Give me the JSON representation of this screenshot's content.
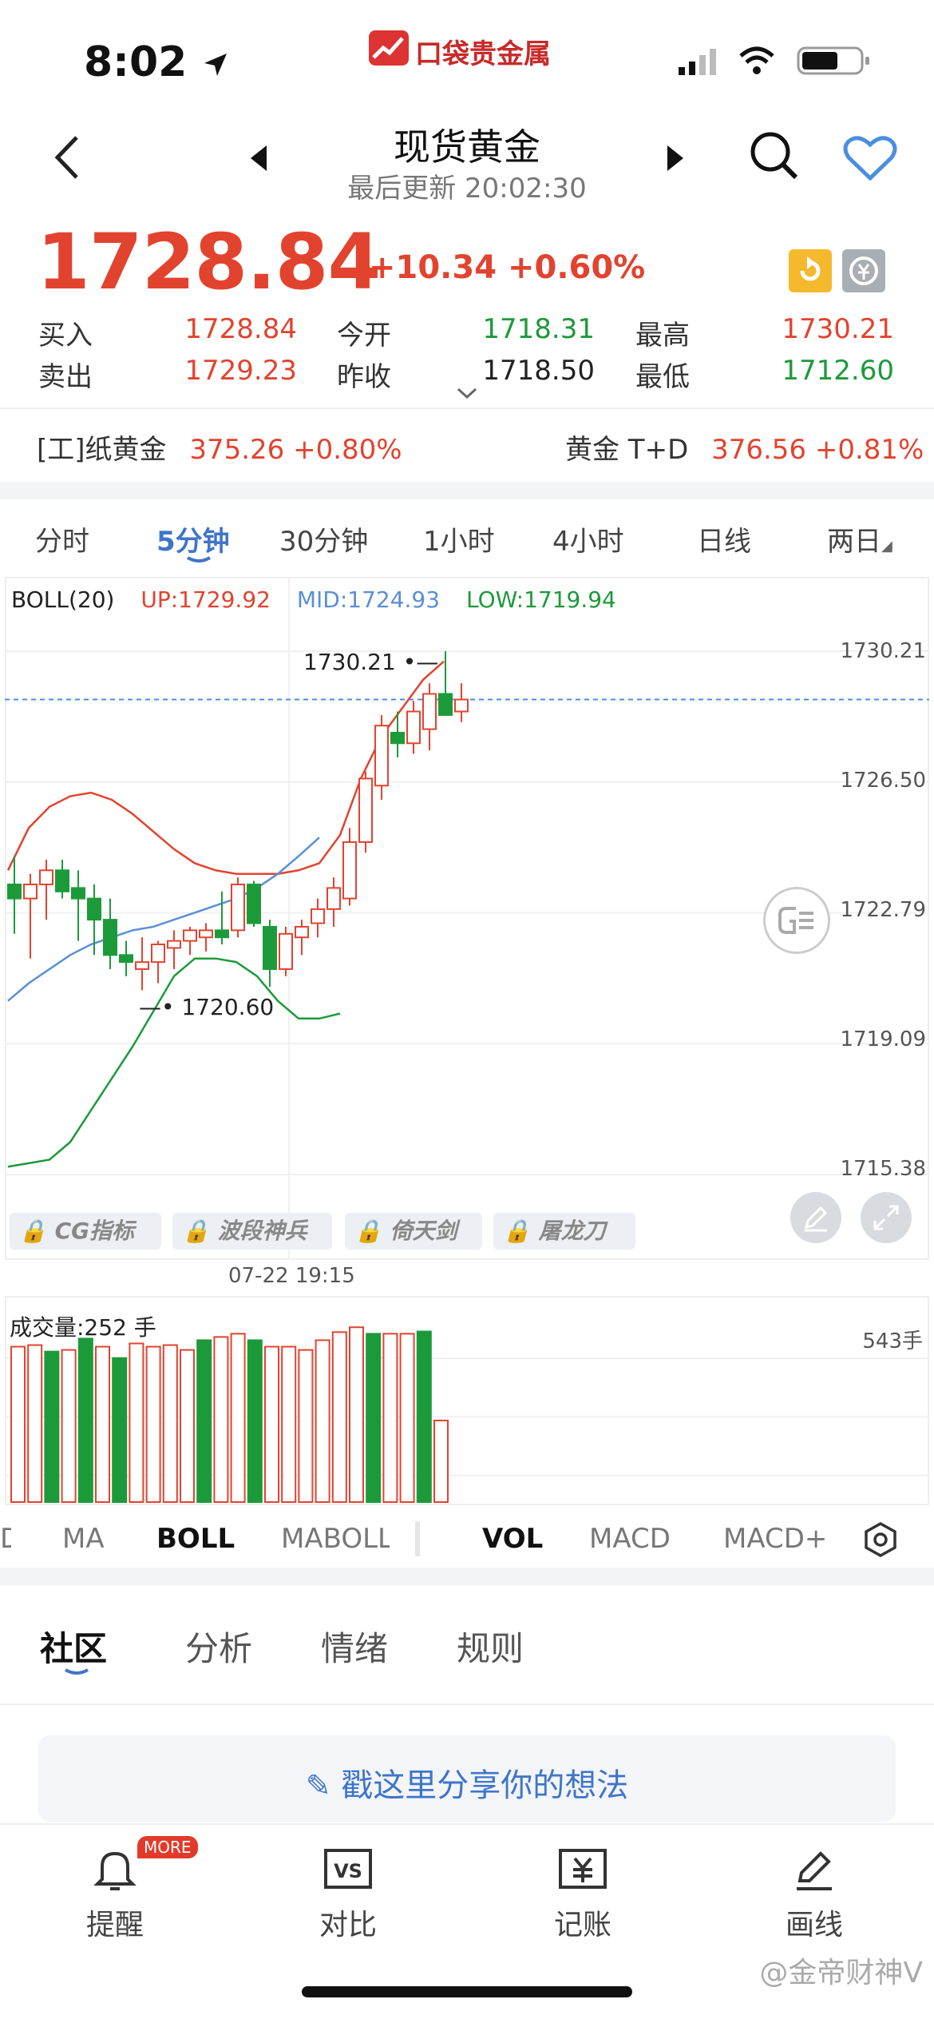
{
  "status_bar": {
    "time": "8:02",
    "app_logo_text": "口袋贵金属",
    "logo_small": "KOUDAI"
  },
  "header": {
    "title": "现货黄金",
    "subtitle": "最后更新 20:02:30"
  },
  "price": {
    "main": "1728.84",
    "change": "+10.34 +0.60%"
  },
  "quote": {
    "buy_label": "买入",
    "buy_value": "1728.84",
    "sell_label": "卖出",
    "sell_value": "1729.23",
    "open_label": "今开",
    "open_value": "1718.31",
    "prev_label": "昨收",
    "prev_value": "1718.50",
    "high_label": "最高",
    "high_value": "1730.21",
    "low_label": "最低",
    "low_value": "1712.60"
  },
  "related": {
    "paper_gold_name": "[工]纸黄金",
    "paper_gold_value": "375.26 +0.80%",
    "td_name": "黄金 T+D",
    "td_value": "376.56 +0.81%"
  },
  "period_tabs": [
    "分时",
    "5分钟",
    "30分钟",
    "1小时",
    "4小时",
    "日线",
    "两日"
  ],
  "boll": {
    "name": "BOLL(20)",
    "up": "UP:1729.92",
    "mid": "MID:1724.93",
    "low": "LOW:1719.94"
  },
  "chart_data": {
    "type": "candlestick",
    "y_ticks": [
      "1730.21",
      "1726.50",
      "1722.79",
      "1719.09",
      "1715.38"
    ],
    "ylim": [
      1715.38,
      1730.21
    ],
    "last_price": 1728.84,
    "high_marker": "1730.21",
    "low_marker": "1720.60",
    "time_label": "07-22 19:15",
    "candles": [
      {
        "o": 1723.6,
        "h": 1724.4,
        "l": 1722.2,
        "c": 1723.2,
        "up": false
      },
      {
        "o": 1723.2,
        "h": 1723.9,
        "l": 1721.5,
        "c": 1723.6,
        "up": true
      },
      {
        "o": 1723.6,
        "h": 1724.3,
        "l": 1722.6,
        "c": 1724.0,
        "up": true
      },
      {
        "o": 1724.0,
        "h": 1724.3,
        "l": 1723.2,
        "c": 1723.4,
        "up": false
      },
      {
        "o": 1723.5,
        "h": 1724.0,
        "l": 1722.0,
        "c": 1723.2,
        "up": false
      },
      {
        "o": 1723.2,
        "h": 1723.6,
        "l": 1721.6,
        "c": 1722.6,
        "up": false
      },
      {
        "o": 1722.6,
        "h": 1723.2,
        "l": 1721.2,
        "c": 1721.6,
        "up": false
      },
      {
        "o": 1721.6,
        "h": 1722.0,
        "l": 1721.0,
        "c": 1721.4,
        "up": false
      },
      {
        "o": 1721.2,
        "h": 1722.1,
        "l": 1720.6,
        "c": 1721.4,
        "up": true
      },
      {
        "o": 1721.4,
        "h": 1722.0,
        "l": 1720.8,
        "c": 1721.9,
        "up": true
      },
      {
        "o": 1721.8,
        "h": 1722.3,
        "l": 1721.2,
        "c": 1722.0,
        "up": true
      },
      {
        "o": 1722.0,
        "h": 1722.4,
        "l": 1721.6,
        "c": 1722.3,
        "up": true
      },
      {
        "o": 1722.1,
        "h": 1722.5,
        "l": 1721.7,
        "c": 1722.3,
        "up": true
      },
      {
        "o": 1722.3,
        "h": 1723.4,
        "l": 1721.9,
        "c": 1722.1,
        "up": false
      },
      {
        "o": 1722.3,
        "h": 1723.8,
        "l": 1722.1,
        "c": 1723.6,
        "up": true
      },
      {
        "o": 1723.6,
        "h": 1723.7,
        "l": 1722.4,
        "c": 1722.5,
        "up": false
      },
      {
        "o": 1722.4,
        "h": 1722.6,
        "l": 1720.7,
        "c": 1721.2,
        "up": false
      },
      {
        "o": 1721.2,
        "h": 1722.4,
        "l": 1721.0,
        "c": 1722.2,
        "up": true
      },
      {
        "o": 1722.1,
        "h": 1722.6,
        "l": 1721.6,
        "c": 1722.4,
        "up": true
      },
      {
        "o": 1722.5,
        "h": 1723.2,
        "l": 1722.1,
        "c": 1722.9,
        "up": true
      },
      {
        "o": 1722.9,
        "h": 1723.8,
        "l": 1722.4,
        "c": 1723.5,
        "up": true
      },
      {
        "o": 1723.2,
        "h": 1725.2,
        "l": 1723.0,
        "c": 1724.8,
        "up": true
      },
      {
        "o": 1724.8,
        "h": 1726.8,
        "l": 1724.5,
        "c": 1726.6,
        "up": true
      },
      {
        "o": 1726.4,
        "h": 1728.4,
        "l": 1726.0,
        "c": 1728.1,
        "up": true
      },
      {
        "o": 1727.9,
        "h": 1728.5,
        "l": 1727.2,
        "c": 1727.6,
        "up": false
      },
      {
        "o": 1727.6,
        "h": 1728.8,
        "l": 1727.3,
        "c": 1728.5,
        "up": true
      },
      {
        "o": 1728.0,
        "h": 1729.3,
        "l": 1727.4,
        "c": 1729.0,
        "up": true
      },
      {
        "o": 1729.0,
        "h": 1730.21,
        "l": 1728.4,
        "c": 1728.4,
        "up": false
      },
      {
        "o": 1728.5,
        "h": 1729.3,
        "l": 1728.2,
        "c": 1728.84,
        "up": true
      }
    ],
    "boll_upper": [
      1724.0,
      1725.2,
      1725.8,
      1726.1,
      1726.2,
      1726.0,
      1725.6,
      1725.1,
      1724.6,
      1724.2,
      1724.0,
      1723.9,
      1723.9,
      1723.9,
      1724.0,
      1724.2,
      1725.0,
      1726.6,
      1727.8,
      1728.6,
      1729.4,
      1729.92
    ],
    "boll_mid": [
      1720.3,
      1720.8,
      1721.2,
      1721.6,
      1721.9,
      1722.1,
      1722.3,
      1722.4,
      1722.6,
      1722.8,
      1723.0,
      1723.2,
      1723.5,
      1723.9,
      1724.4,
      1724.93
    ],
    "boll_lower": [
      1715.6,
      1715.7,
      1715.8,
      1716.3,
      1717.2,
      1718.1,
      1719.0,
      1720.0,
      1721.0,
      1721.5,
      1721.5,
      1721.4,
      1721.0,
      1720.3,
      1719.8,
      1719.8,
      1719.94
    ],
    "volume_label": "成交量:252 手",
    "volume_max_label": "543手",
    "volumes": [
      {
        "v": 480,
        "up": true
      },
      {
        "v": 485,
        "up": true
      },
      {
        "v": 465,
        "up": false
      },
      {
        "v": 470,
        "up": true
      },
      {
        "v": 505,
        "up": false
      },
      {
        "v": 480,
        "up": true
      },
      {
        "v": 445,
        "up": false
      },
      {
        "v": 490,
        "up": true
      },
      {
        "v": 480,
        "up": true
      },
      {
        "v": 485,
        "up": true
      },
      {
        "v": 470,
        "up": true
      },
      {
        "v": 500,
        "up": false
      },
      {
        "v": 510,
        "up": true
      },
      {
        "v": 520,
        "up": true
      },
      {
        "v": 500,
        "up": false
      },
      {
        "v": 480,
        "up": true
      },
      {
        "v": 480,
        "up": true
      },
      {
        "v": 470,
        "up": true
      },
      {
        "v": 500,
        "up": true
      },
      {
        "v": 525,
        "up": true
      },
      {
        "v": 540,
        "up": true
      },
      {
        "v": 520,
        "up": false
      },
      {
        "v": 520,
        "up": true
      },
      {
        "v": 520,
        "up": true
      },
      {
        "v": 527,
        "up": false
      },
      {
        "v": 252,
        "up": true
      }
    ]
  },
  "tool_chips": [
    "CG指标",
    "波段神兵",
    "倚天剑",
    "屠龙刀"
  ],
  "indicator_tabs": [
    "D",
    "MA",
    "BOLL",
    "MABOLL",
    "VOL",
    "MACD",
    "MACD+"
  ],
  "community_tabs": [
    "社区",
    "分析",
    "情绪",
    "规则"
  ],
  "share_prompt": "戳这里分享你的想法",
  "bottom_nav": [
    {
      "label": "提醒",
      "icon": "bell-icon"
    },
    {
      "label": "对比",
      "icon": "vs-icon"
    },
    {
      "label": "记账",
      "icon": "ledger-icon"
    },
    {
      "label": "画线",
      "icon": "draw-line-icon"
    }
  ],
  "more_badge": "MORE",
  "watermark": "@金帝财神V",
  "colors": {
    "up": "#e2432f",
    "down": "#1c9a3a",
    "accent": "#3f75c9",
    "boll_mid": "#5b8fd6"
  }
}
